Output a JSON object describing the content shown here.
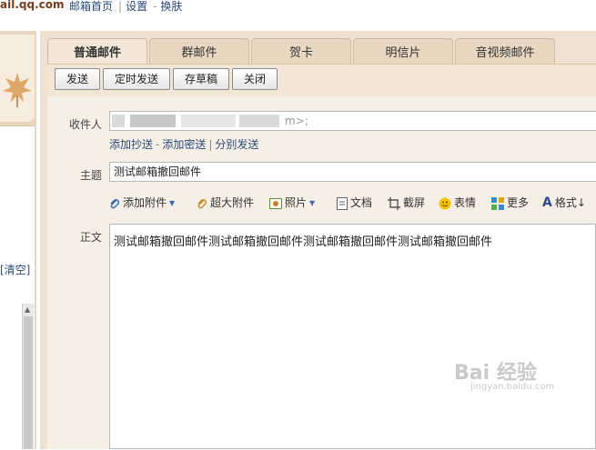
{
  "header": {
    "brand": "ail.qq.com",
    "links": [
      "邮箱首页",
      "设置",
      "换肤"
    ]
  },
  "sidebar": {
    "clear_label": "[清空]"
  },
  "tabs": [
    "普通邮件",
    "群邮件",
    "贺卡",
    "明信片",
    "音视频邮件"
  ],
  "toolbar": {
    "send": "发送",
    "scheduled": "定时发送",
    "draft": "存草稿",
    "close": "关闭"
  },
  "compose": {
    "to_label": "收件人",
    "to_value_tail": "m>;",
    "add_cc": "添加抄送",
    "add_bcc": "添加密送",
    "separate_send": "分别发送",
    "subject_label": "主题",
    "subject_value": "测试邮箱撤回邮件",
    "body_label": "正文",
    "body_text": "测试邮箱撤回邮件测试邮箱撤回邮件测试邮箱撤回邮件测试邮箱撤回邮件"
  },
  "attach_bar": {
    "add_attachment": "添加附件",
    "large_attachment": "超大附件",
    "photo": "照片",
    "document": "文档",
    "screenshot": "截屏",
    "emoji": "表情",
    "more": "更多",
    "format": "格式↓"
  },
  "watermark": {
    "main": "Bai  经验",
    "sub": "jingyan.baidu.com"
  }
}
